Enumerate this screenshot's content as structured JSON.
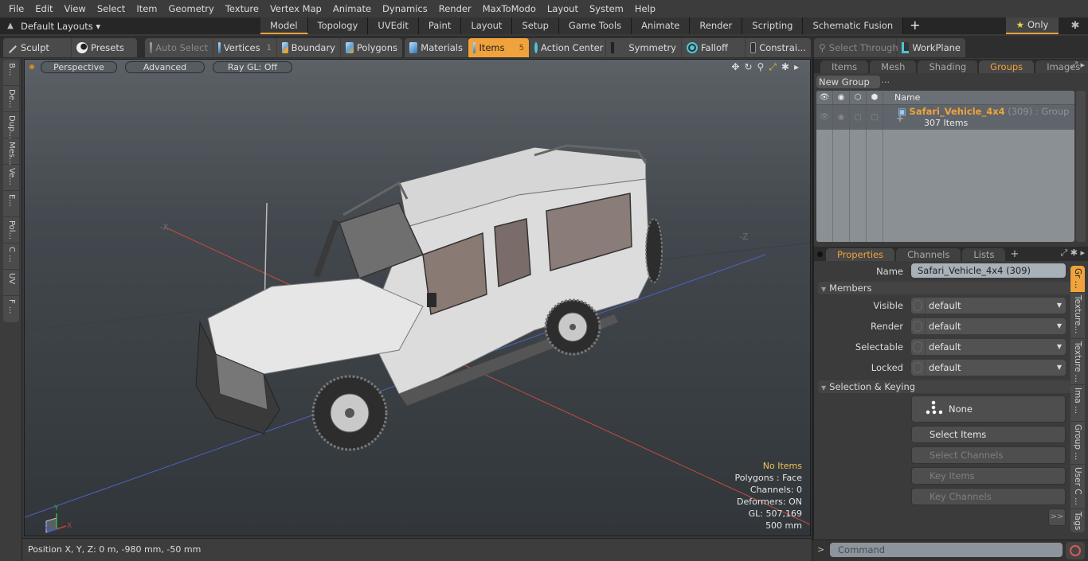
{
  "menu": [
    "File",
    "Edit",
    "View",
    "Select",
    "Item",
    "Geometry",
    "Texture",
    "Vertex Map",
    "Animate",
    "Dynamics",
    "Render",
    "MaxToModo",
    "Layout",
    "System",
    "Help"
  ],
  "layout_bar": {
    "default_layouts": "Default Layouts ▾",
    "tabs": [
      "Model",
      "Topology",
      "UVEdit",
      "Paint",
      "Layout",
      "Setup",
      "Game Tools",
      "Animate",
      "Render",
      "Scripting",
      "Schematic Fusion"
    ],
    "active_tab": "Model",
    "add_label": "+",
    "only_label": "Only"
  },
  "toolbar": {
    "sculpt": "Sculpt",
    "presets": "Presets",
    "auto_select": "Auto Select",
    "vertices": "Vertices",
    "vertices_count": "1",
    "boundary": "Boundary",
    "polygons": "Polygons",
    "materials": "Materials",
    "items": "Items",
    "items_count": "5",
    "action_center": "Action Center",
    "symmetry": "Symmetry",
    "falloff": "Falloff",
    "constraints": "Constrai...",
    "select_through": "Select Through",
    "workplane": "WorkPlane"
  },
  "left_tabs": [
    "B...",
    "De...",
    "Dup...",
    "Mes...",
    "Ve...",
    "E...",
    "Pol...",
    "C ...",
    "UV",
    "F ..."
  ],
  "viewport": {
    "view_mode": "Perspective",
    "shading": "Advanced",
    "raygl": "Ray GL: Off",
    "axis_neg_x": "-X",
    "axis_neg_z": "-Z",
    "stats": {
      "selection": "No Items",
      "polygons": "Polygons : Face",
      "channels": "Channels: 0",
      "deformers": "Deformers: ON",
      "gl": "GL: 507,169",
      "scale": "500 mm"
    },
    "gizmo": {
      "x": "X",
      "y": "Y",
      "z": "Z"
    }
  },
  "status_bar": {
    "position": "Position X, Y, Z:   0 m, -980 mm, -50 mm"
  },
  "groups_panel": {
    "tabs": [
      "Items",
      "Mesh ...",
      "Shading",
      "Groups",
      "Images"
    ],
    "active_tab": "Groups",
    "new_group": "New Group",
    "column_name": "Name",
    "group": {
      "name": "Safari_Vehicle_4x4",
      "count": " (309)",
      "type": " : Group",
      "items": "307 Items"
    }
  },
  "properties_panel": {
    "tabs": [
      "Properties",
      "Channels",
      "Lists"
    ],
    "active_tab": "Properties",
    "name_label": "Name",
    "name_value": "Safari_Vehicle_4x4 (309)",
    "members_section": "Members",
    "fields": [
      {
        "label": "Visible",
        "value": "default"
      },
      {
        "label": "Render",
        "value": "default"
      },
      {
        "label": "Selectable",
        "value": "default"
      },
      {
        "label": "Locked",
        "value": "default"
      }
    ],
    "selection_section": "Selection & Keying",
    "none_button": "None",
    "select_items": "Select Items",
    "select_channels": "Select Channels",
    "key_items": "Key Items",
    "key_channels": "Key Channels",
    "more": ">>",
    "side_tabs": [
      "Gr ...",
      "Texture...",
      "Texture ...",
      "Ima ...",
      "Group ...",
      "User C ...",
      "Tags"
    ]
  },
  "command_bar": {
    "prompt": ">",
    "placeholder": "Command"
  },
  "colors": {
    "accent": "#f0a23c",
    "group_name": "#f0a23c",
    "warn_text": "#f2c157"
  }
}
